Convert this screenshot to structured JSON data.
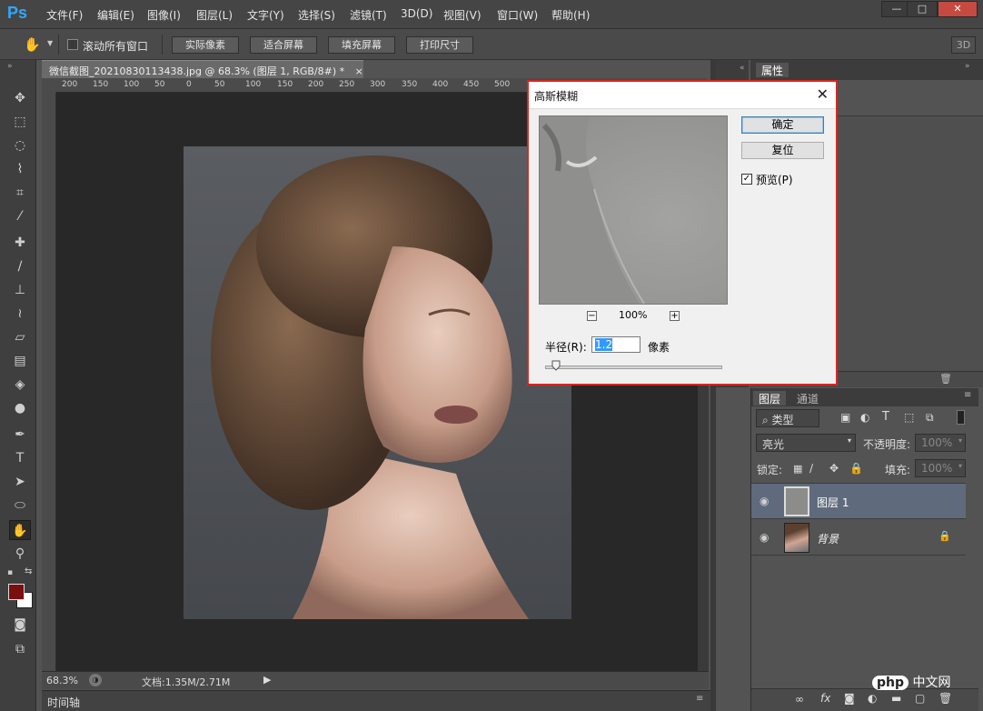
{
  "app": {
    "logo": "Ps"
  },
  "menu": [
    "文件(F)",
    "编辑(E)",
    "图像(I)",
    "图层(L)",
    "文字(Y)",
    "选择(S)",
    "滤镜(T)",
    "3D(D)",
    "视图(V)",
    "窗口(W)",
    "帮助(H)"
  ],
  "window_buttons": {
    "minimize": "—",
    "maximize": "□",
    "close": "✕"
  },
  "options": {
    "scroll_all_label": "滚动所有窗口",
    "buttons": [
      "实际像素",
      "适合屏幕",
      "填充屏幕",
      "打印尺寸"
    ],
    "mode_3d": "3D"
  },
  "document": {
    "tab_title": "微信截图_20210830113438.jpg @ 68.3% (图层 1, RGB/8#) *",
    "tab_close": "×",
    "ruler_ticks": [
      "200",
      "150",
      "100",
      "50",
      "0",
      "50",
      "100",
      "150",
      "200",
      "250",
      "300",
      "350",
      "400",
      "450",
      "500"
    ],
    "zoom": "68.3%",
    "doc_size": "文档:1.35M/2.71M"
  },
  "timeline_label": "时间轴",
  "right_panel": {
    "props_tab": "属性"
  },
  "layers_panel": {
    "tabs": [
      "图层",
      "通道"
    ],
    "filter_kind": "类型",
    "blend_mode": "亮光",
    "opacity_label": "不透明度:",
    "opacity_value": "100%",
    "lock_label": "锁定:",
    "fill_label": "填充:",
    "fill_value": "100%",
    "layers": [
      {
        "name": "图层 1",
        "selected": true
      },
      {
        "name": "背景",
        "locked": true
      }
    ],
    "footer_icons": [
      "link-icon",
      "fx-icon",
      "mask-icon",
      "adjustment-icon",
      "folder-icon",
      "new-layer-icon",
      "trash-icon"
    ],
    "fx_label": "fx"
  },
  "dialog": {
    "title": "高斯模糊",
    "ok": "确定",
    "reset": "复位",
    "preview_label": "预览(P)",
    "preview_checked": true,
    "zoom_out": "−",
    "zoom_in": "+",
    "zoom_level": "100%",
    "radius_label": "半径(R):",
    "radius_value": "1.2",
    "unit": "像素",
    "radius_slider": 0.06
  },
  "colors": {
    "foreground": "#7a0f0f",
    "background": "#ffffff",
    "dialog_highlight": "#d9261f"
  },
  "watermark": "php 中文网"
}
